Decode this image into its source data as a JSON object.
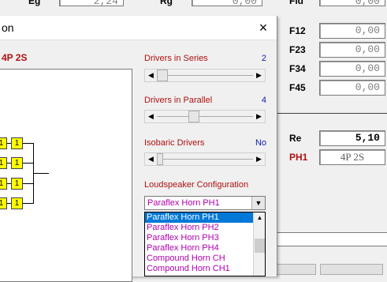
{
  "background": {
    "top_labels": [
      {
        "text": "Eg"
      },
      {
        "text": "Rg"
      },
      {
        "text": "Fld"
      }
    ],
    "top_values": [
      "2,24",
      "0,00",
      "0,00"
    ],
    "rows": [
      {
        "label": "F12",
        "value": "0,00"
      },
      {
        "label": "F23",
        "value": "0,00"
      },
      {
        "label": "F34",
        "value": "0,00"
      },
      {
        "label": "F45",
        "value": "0,00"
      }
    ],
    "re": {
      "label": "Re",
      "value": "5,10"
    },
    "ph1": {
      "label": "PH1",
      "value": "4P 2S"
    }
  },
  "dialog": {
    "title": "on",
    "close_label": "×",
    "config_label": "4P 2S",
    "drivers_series": {
      "label": "Drivers in Series",
      "value": "2"
    },
    "drivers_parallel": {
      "label": "Drivers in Parallel",
      "value": "4"
    },
    "isobaric": {
      "label": "Isobaric Drivers",
      "value": "No"
    },
    "loudspeaker_config": {
      "label": "Loudspeaker Configuration",
      "selected": "Paraflex Horn PH1",
      "options": [
        "Paraflex Horn PH1",
        "Paraflex Horn PH2",
        "Paraflex Horn PH3",
        "Paraflex Horn PH4",
        "Compound Horn CH",
        "Compound Horn CH1"
      ]
    },
    "driver_box_label": "1"
  },
  "colors": {
    "accent_red": "#b01010",
    "accent_blue": "#1020b0",
    "option_magenta": "#b000b0",
    "selection": "#0078d7"
  }
}
